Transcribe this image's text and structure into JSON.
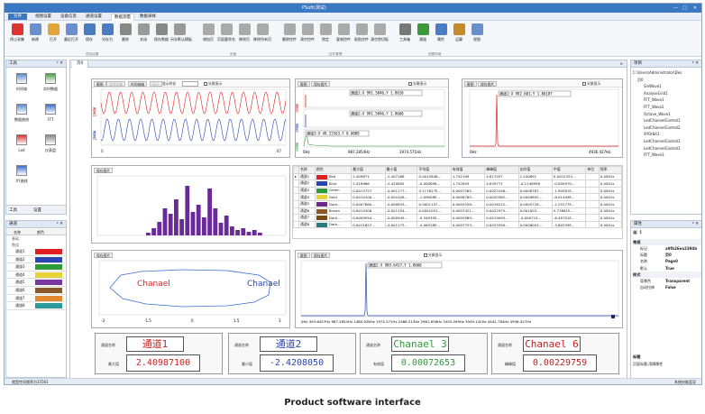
{
  "app": {
    "title": "PSoft(测试)"
  },
  "menu": [
    "文件",
    "视图设置",
    "设备信息",
    "通道设置",
    "数据测量",
    "数据采样"
  ],
  "ribbon": {
    "buttons": [
      {
        "label": "停止采集",
        "color": "#d33"
      },
      {
        "label": "新建",
        "color": "#6a8fcf"
      },
      {
        "label": "打开",
        "color": "#e0a83a"
      },
      {
        "label": "最近打开",
        "color": "#6a8fcf"
      },
      {
        "label": "保存",
        "color": "#4a7cc4"
      },
      {
        "label": "另存为",
        "color": "#4a7cc4"
      },
      {
        "label": "删除",
        "color": "#888"
      },
      {
        "label": "关闭",
        "color": "#999"
      },
      {
        "label": "保存数据",
        "color": "#888"
      },
      {
        "label": "另存默认模板",
        "color": "#999"
      },
      {
        "label": "增加页",
        "color": "#aaa"
      },
      {
        "label": "页面重命名",
        "color": "#aaa"
      },
      {
        "label": "移除页",
        "color": "#aaa"
      },
      {
        "label": "移除所有页",
        "color": "#aaa"
      },
      {
        "label": "删除控件",
        "color": "#aaa"
      },
      {
        "label": "清空控件",
        "color": "#aaa"
      },
      {
        "label": "锁定",
        "color": "#aaa"
      },
      {
        "label": "复制控件",
        "color": "#aaa"
      },
      {
        "label": "粘贴控件",
        "color": "#aaa"
      },
      {
        "label": "清空剪切板",
        "color": "#aaa"
      },
      {
        "label": "工具箱",
        "color": "#777"
      },
      {
        "label": "通道",
        "color": "#3a9a3a"
      },
      {
        "label": "属性",
        "color": "#4a7cc4"
      },
      {
        "label": "运算",
        "color": "#c58a2a"
      },
      {
        "label": "视图",
        "color": "#6a8fcf"
      }
    ],
    "groups": [
      "项目设置",
      "页面",
      "控件管理",
      "视图布局"
    ]
  },
  "toolbox": {
    "title": "工具",
    "items": [
      "时间域",
      "实时数据",
      "数据曲线",
      "FFT",
      "Led",
      "仪表盘",
      "XY曲线",
      "通道"
    ],
    "tabs": [
      "工具",
      "设置"
    ]
  },
  "channels": {
    "title": "通道",
    "headers": [
      "名称",
      "颜色"
    ],
    "groups": [
      "基础",
      "数组"
    ],
    "rows": [
      {
        "name": "通道1",
        "color": "#e02020"
      },
      {
        "name": "通道2",
        "color": "#2a46b0"
      },
      {
        "name": "通道3",
        "color": "#2e9a3a"
      },
      {
        "name": "通道4",
        "color": "#e8d23a"
      },
      {
        "name": "通道5",
        "color": "#7a36a0"
      },
      {
        "name": "通道6",
        "color": "#8a5a2a"
      },
      {
        "name": "通道7",
        "color": "#e08a30"
      },
      {
        "name": "通道8",
        "color": "#2a9a9a"
      }
    ]
  },
  "doc_tab": "页0",
  "panel1": {
    "buttons": [
      "截图",
      "暂停采集",
      "时间轴轴",
      "指示"
    ],
    "check": "分屏显示",
    "label": "显示时长",
    "x_start": "0",
    "x_end": "87"
  },
  "panel2": {
    "buttons": [
      "截图",
      "保存图片"
    ],
    "check": "分屏显示",
    "cursor1": "通道1:X 991.5046,Y 1.8618",
    "cursor2": "通道2:X 991.5046,Y 1.8660",
    "cursor3": "通道3:X 49.22563,Y 0.0009",
    "ticks": [
      "0Hz",
      "987.2854Hz",
      "1974.571Hz"
    ]
  },
  "panel3": {
    "buttons": [
      "截图",
      "保存图片"
    ],
    "check": "分屏显示",
    "cursor": "通道1:X 992.601,Y 1.86187",
    "ticks": [
      "0Hz",
      "4936.427Hz"
    ]
  },
  "panel4": {
    "buttons": [
      "保存图片"
    ]
  },
  "table": {
    "headers": [
      "名称",
      "颜色",
      "最大值",
      "最小值",
      "平均值",
      "有效值",
      "峰峰值",
      "实时值",
      "中值",
      "单位",
      "频率"
    ],
    "rows": [
      [
        "通道1",
        "Red",
        "2.409871",
        "-2.407166",
        "0.0015846...",
        "1.742109",
        "4.817037",
        "1.240691",
        "0.0012525...",
        "",
        "0.0001s"
      ],
      [
        "通道2",
        "Blue",
        "2.418966",
        "-2.420805",
        "-0.000898...",
        "1.742859",
        "4.839771",
        "-0.1146998",
        "-0.000970...",
        "",
        "0.0001s"
      ],
      [
        "通道3",
        "Green",
        "0.0013757",
        "-0.001177...",
        "4.117627E...",
        "0.0007265...",
        "0.0023148...",
        "0.0008767...",
        "-1.90581E...",
        "",
        "0.0001s"
      ],
      [
        "通道4",
        "Gold",
        "0.0010100...",
        "-0.001026...",
        "-1.09008E...",
        "0.0006765...",
        "0.0020362...",
        "0.0009892...",
        "-8.01449E...",
        "",
        "0.0001s"
      ],
      [
        "通道5",
        "Dark...",
        "0.0007860...",
        "-0.000833...",
        "0.0001107...",
        "0.0005258...",
        "0.0016212...",
        "0.0005728...",
        "-2.25277E...",
        "",
        "0.0001s"
      ],
      [
        "通道6",
        "Brown",
        "0.0014306",
        "-0.001154...",
        "0.0001051...",
        "0.0007421...",
        "0.0022975...",
        "0.001003...",
        "5.73881E...",
        "",
        "0.0001s"
      ],
      [
        "通道7",
        "Dark...",
        "0.0009594...",
        "-0.000949...",
        "-9.34935E...",
        "0.0005989...",
        "0.0019093...",
        "-0.000719...",
        "-6.49701E...",
        "",
        "0.0001s"
      ],
      [
        "通道8",
        "Dark...",
        "0.0011657...",
        "-0.001173...",
        "-4.06528E...",
        "0.0007723...",
        "0.0023390...",
        "0.0008003...",
        "-3.80259E...",
        "",
        "0.0001s"
      ]
    ],
    "colors": [
      "#e02020",
      "#2a46b0",
      "#2e9a3a",
      "#e8d23a",
      "#6a2a8a",
      "#8a5a2a",
      "#7a4a10",
      "#2a7a7a"
    ]
  },
  "panel5": {
    "buttons": [
      "保存图片"
    ],
    "label_left": "Chanael",
    "label_right": "Chanael",
    "ticks": [
      "-3",
      "-1.5",
      "0",
      "1.5",
      "3"
    ]
  },
  "panel6": {
    "buttons": [
      "截图",
      "保存图片"
    ],
    "check": "分屏显示",
    "cursor": "通道2:X 989.6417,Y 1.8660",
    "ticks": "0Hz   493.6427Hz 987.2854Hz 1480.928Hz 1974.571Hz 2468.213Hz 2961.856Hz 3455.499Hz 3949.142Hz 4442.784Hz 4936.427Hz"
  },
  "leds": [
    {
      "title": "通道1",
      "stat": "最大值",
      "value": "2.40987100",
      "tcolor": "#d02020",
      "vcolor": "#d02020"
    },
    {
      "title": "通道2",
      "stat": "最小值",
      "value": "-2.4208050",
      "tcolor": "#2a46b0",
      "vcolor": "#2a46b0"
    },
    {
      "title": "Chanael 3",
      "stat": "有效值",
      "value": "0.00072653",
      "tcolor": "#2e9a3a",
      "vcolor": "#2e9a3a"
    },
    {
      "title": "Chanael 6",
      "stat": "峰峰值",
      "value": "0.00229759",
      "tcolor": "#c02020",
      "vcolor": "#c02020"
    }
  ],
  "project": {
    "title": "项目",
    "root": "C:\\Users\\Administrator\\Des",
    "page": "页0",
    "items": [
      "SinWave1",
      "AnalyseGrid1",
      "FFT_Wave1",
      "FFT_Wave2",
      "Octave_Wave1",
      "LedChannelControl1",
      "LedChannelControl2",
      "XYOrbit1",
      "LedChannelControl1",
      "LedChannelControl1",
      "FFT_Wave3"
    ]
  },
  "properties": {
    "title": "属性",
    "cat1": "常规",
    "rows1": [
      [
        "标记",
        "a9fb26ea2394b"
      ],
      [
        "标题",
        "页0"
      ],
      [
        "名称",
        "Page0"
      ],
      [
        "默认",
        "True"
      ]
    ],
    "cat2": "样式",
    "rows2": [
      [
        "背景色",
        "Transparent"
      ],
      [
        "自动拉伸",
        "False"
      ]
    ],
    "desc_title": "标题",
    "desc": "页面标题,用脚属性"
  },
  "status": {
    "left": "就是传间频率为15561",
    "right": "系统技能蓝导"
  },
  "caption": "Product software interface"
}
